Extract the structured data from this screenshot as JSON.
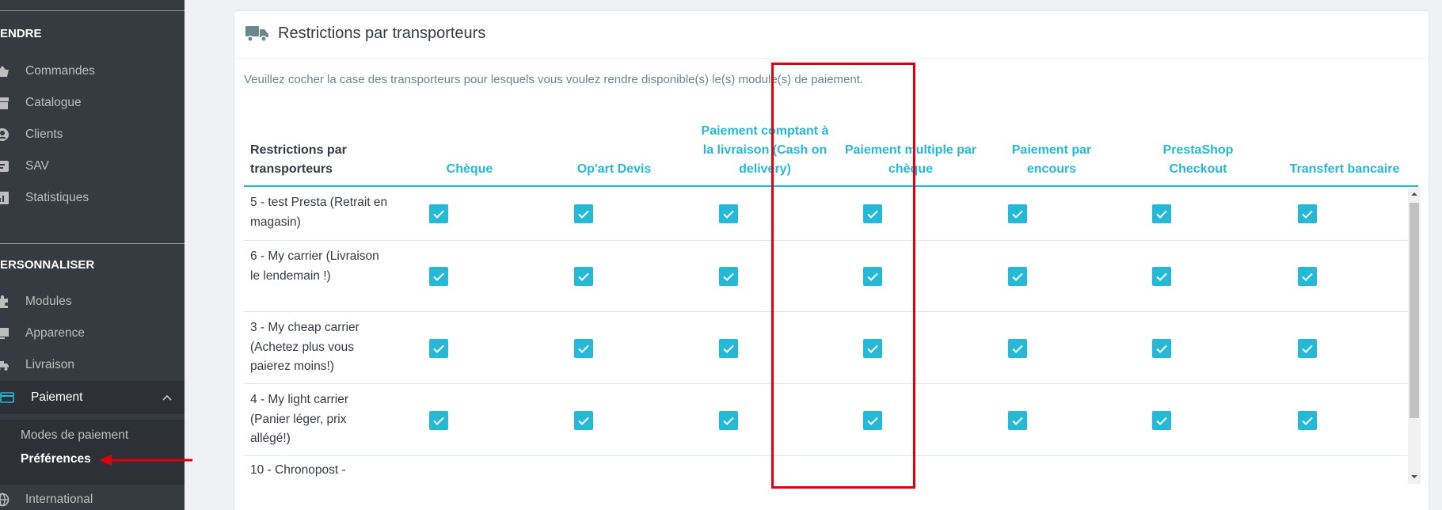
{
  "sidebar": {
    "section_sell": "ENDRE",
    "section_customize": "ERSONNALISER",
    "items": [
      {
        "label": "Commandes",
        "icon": "basket-icon"
      },
      {
        "label": "Catalogue",
        "icon": "store-icon"
      },
      {
        "label": "Clients",
        "icon": "user-circle-icon"
      },
      {
        "label": "SAV",
        "icon": "message-icon"
      },
      {
        "label": "Statistiques",
        "icon": "chart-icon"
      },
      {
        "label": "Modules",
        "icon": "puzzle-icon"
      },
      {
        "label": "Apparence",
        "icon": "monitor-icon"
      },
      {
        "label": "Livraison",
        "icon": "truck-icon"
      },
      {
        "label": "Paiement",
        "icon": "credit-card-icon"
      },
      {
        "label": "International",
        "icon": "globe-icon"
      }
    ],
    "subitems": [
      {
        "label": "Modes de paiement"
      },
      {
        "label": "Préférences"
      }
    ]
  },
  "panel": {
    "title": "Restrictions par transporteurs",
    "help": "Veuillez cocher la case des transporteurs pour lesquels vous voulez rendre disponible(s) le(s) module(s) de paiement."
  },
  "table": {
    "columns": [
      "Restrictions par transporteurs",
      "Chèque",
      "Op'art Devis",
      "Paiement comptant à la livraison (Cash on delivery)",
      "Paiement multiple par chèque",
      "Paiement par encours",
      "PrestaShop Checkout",
      "Transfert bancaire"
    ],
    "rows": [
      {
        "name": "5 - test Presta (Retrait en magasin)",
        "checked": [
          true,
          true,
          true,
          true,
          true,
          true,
          true
        ]
      },
      {
        "name": "6 - My carrier (Livraison le lendemain !)",
        "checked": [
          true,
          true,
          true,
          true,
          true,
          true,
          true
        ]
      },
      {
        "name": "3 - My cheap carrier (Achetez plus vous paierez moins!)",
        "checked": [
          true,
          true,
          true,
          true,
          true,
          true,
          true
        ]
      },
      {
        "name": "4 - My light carrier (Panier léger, prix allégé!)",
        "checked": [
          true,
          true,
          true,
          true,
          true,
          true,
          true
        ]
      },
      {
        "name": "10 - Chronopost -",
        "checked": []
      }
    ]
  },
  "colors": {
    "accent": "#25b9d7",
    "sidebar_bg": "#363a41",
    "annotation": "#e0000d"
  }
}
